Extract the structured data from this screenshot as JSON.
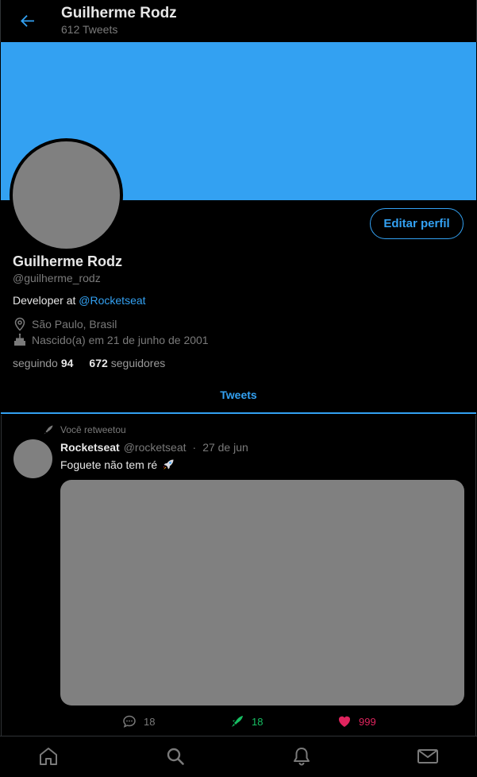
{
  "header": {
    "back_icon": "arrow-left-icon",
    "title": "Guilherme Rodz",
    "subtitle": "612 Tweets"
  },
  "profile": {
    "name": "Guilherme Rodz",
    "handle": "@guilherme_rodz",
    "bio_prefix": "Developer at ",
    "bio_link": "@Rocketseat",
    "location": "São Paulo, Brasil",
    "birth": "Nascido(a) em 21 de junho de 2001",
    "following_label": "seguindo",
    "following_count": "94",
    "followers_count": "672",
    "followers_label": "seguidores",
    "edit_button": "Editar perfil"
  },
  "tabs": {
    "active": "Tweets"
  },
  "tweet": {
    "retweet_note": "Você retweetou",
    "author": "Rocketseat",
    "handle": "@rocketseat",
    "separator": "·",
    "date": "27 de jun",
    "text": "Foguete não tem ré",
    "emoji": "rocket-icon",
    "comments": "18",
    "retweets": "18",
    "likes": "999"
  },
  "colors": {
    "accent": "#33a1f2",
    "retweet": "#17bf63",
    "like": "#e0245e",
    "placeholder": "#808080"
  },
  "bottom_nav": [
    "home-icon",
    "search-icon",
    "bell-icon",
    "mail-icon"
  ]
}
